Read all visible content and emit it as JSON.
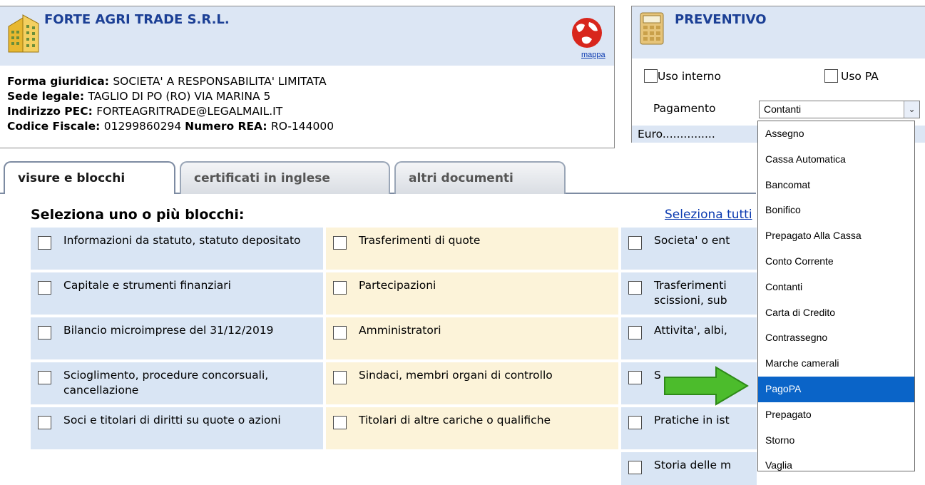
{
  "company": {
    "name": "FORTE AGRI TRADE S.R.L.",
    "map_label": "mappa",
    "info": [
      {
        "label": "Forma giuridica",
        "value": "SOCIETA' A RESPONSABILITA' LIMITATA"
      },
      {
        "label": "Sede legale",
        "value": "TAGLIO DI PO (RO) VIA MARINA 5"
      },
      {
        "label": "Indirizzo PEC",
        "value": "FORTEAGRITRADE@LEGALMAIL.IT"
      }
    ],
    "fiscal": {
      "label": "Codice Fiscale",
      "value": "01299860294",
      "rea_label": "Numero REA",
      "rea_value": "RO-144000"
    }
  },
  "preventivo": {
    "title": "PREVENTIVO",
    "uso_interno": "Uso interno",
    "uso_pa": "Uso PA",
    "payment_label": "Pagamento",
    "payment_value": "Contanti",
    "euro": "Euro..............."
  },
  "tabs": [
    "visure e blocchi",
    "certificati in inglese",
    "altri documenti"
  ],
  "section": {
    "title": "Seleziona uno o più blocchi:",
    "select_all": "Seleziona tutti"
  },
  "blocks": {
    "col1": [
      "Informazioni da statuto, statuto depositato",
      "Capitale e strumenti finanziari",
      "Bilancio microimprese del 31/12/2019",
      "Scioglimento, procedure concorsuali, cancellazione",
      "Soci e titolari di diritti su quote o azioni"
    ],
    "col2": [
      "Trasferimenti di quote",
      "Partecipazioni",
      "Amministratori",
      "Sindaci, membri organi di controllo",
      "Titolari di altre cariche o qualifiche"
    ],
    "col3": [
      "Societa' o ent",
      "Trasferimenti",
      "scissioni, sub",
      "Attivita', albi,",
      "S",
      "Pratiche in ist",
      "Storia delle m"
    ]
  },
  "dropdown": {
    "options": [
      "Assegno",
      "Cassa Automatica",
      "Bancomat",
      "Bonifico",
      "Prepagato Alla Cassa",
      "Conto Corrente",
      "Contanti",
      "Carta di Credito",
      "Contrassegno",
      "Marche camerali",
      "PagoPA",
      "Prepagato",
      "Storno",
      "Vaglia"
    ],
    "selected": "PagoPA"
  },
  "colors": {
    "accent_blue": "#1b3f95",
    "cell_blue": "#d9e5f4",
    "cell_yellow": "#fcf3d9",
    "selected": "#0a64c8",
    "arrow_green": "#4cbc2c"
  }
}
